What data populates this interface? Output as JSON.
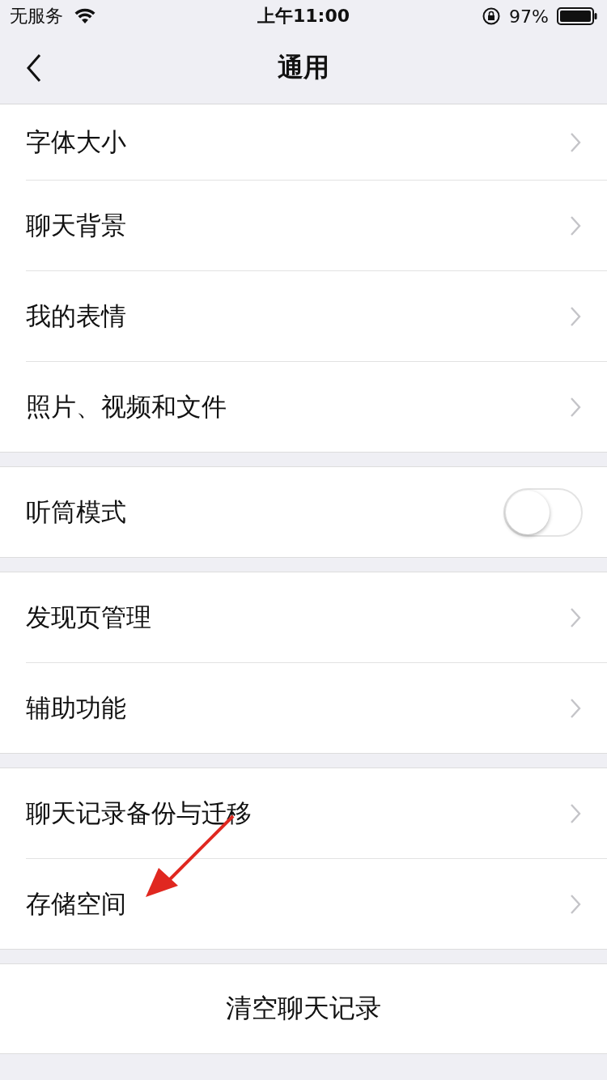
{
  "status_bar": {
    "carrier": "无服务",
    "time": "上午11:00",
    "battery": "97%"
  },
  "nav": {
    "title": "通用"
  },
  "groups": [
    {
      "items": [
        {
          "kind": "link",
          "label": "字体大小"
        },
        {
          "kind": "link",
          "label": "聊天背景"
        },
        {
          "kind": "link",
          "label": "我的表情"
        },
        {
          "kind": "link",
          "label": "照片、视频和文件"
        }
      ]
    },
    {
      "items": [
        {
          "kind": "toggle",
          "label": "听筒模式",
          "on": false
        }
      ]
    },
    {
      "items": [
        {
          "kind": "link",
          "label": "发现页管理"
        },
        {
          "kind": "link",
          "label": "辅助功能"
        }
      ]
    },
    {
      "items": [
        {
          "kind": "link",
          "label": "聊天记录备份与迁移"
        },
        {
          "kind": "link",
          "label": "存储空间"
        }
      ]
    }
  ],
  "action": "清空聊天记录"
}
